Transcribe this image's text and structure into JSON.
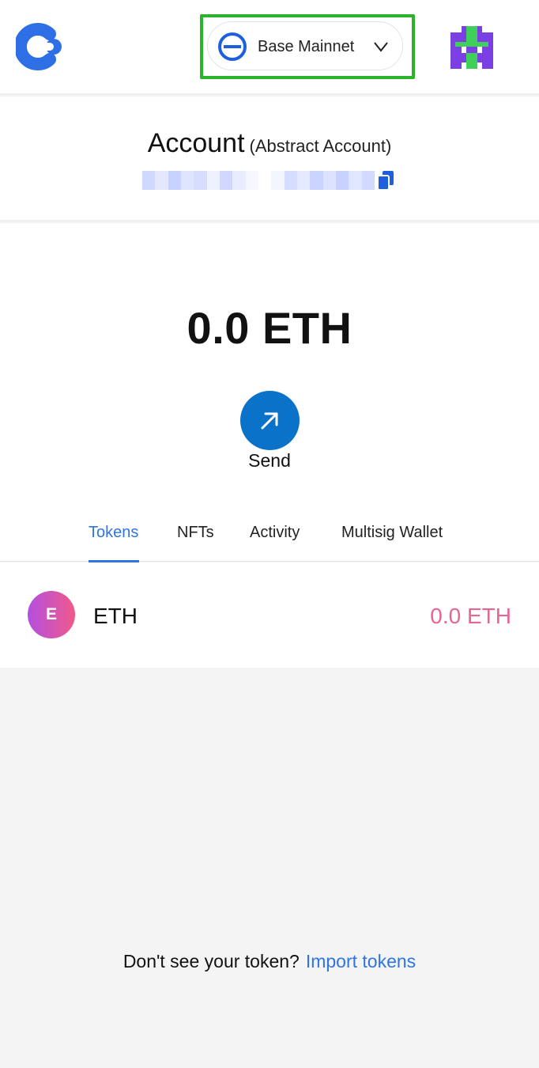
{
  "header": {
    "logo_icon": "brand-logo-icon",
    "network": {
      "label": "Base Mainnet",
      "icon": "base-network-icon",
      "chevron": "chevron-down-icon",
      "highlight_color": "#2cb32c"
    },
    "avatar_icon": "account-avatar-icon"
  },
  "account": {
    "name": "Account",
    "type": "(Abstract Account)",
    "copy_icon": "copy-icon"
  },
  "balance": {
    "amount": "0.0 ETH"
  },
  "actions": {
    "send_label": "Send",
    "send_icon": "arrow-up-right-icon",
    "send_color": "#0a73c9"
  },
  "tabs": [
    {
      "label": "Tokens",
      "active": true
    },
    {
      "label": "NFTs",
      "active": false
    },
    {
      "label": "Activity",
      "active": false
    },
    {
      "label": "Multisig Wallet",
      "active": false
    }
  ],
  "tokens": [
    {
      "avatar_letter": "E",
      "symbol": "ETH",
      "amount": "0.0 ETH"
    }
  ],
  "footer": {
    "question": "Don't see your token?",
    "link": "Import tokens"
  },
  "colors": {
    "accent": "#2f74e0",
    "token_amount": "#e86494",
    "background": "#f4f4f4"
  }
}
